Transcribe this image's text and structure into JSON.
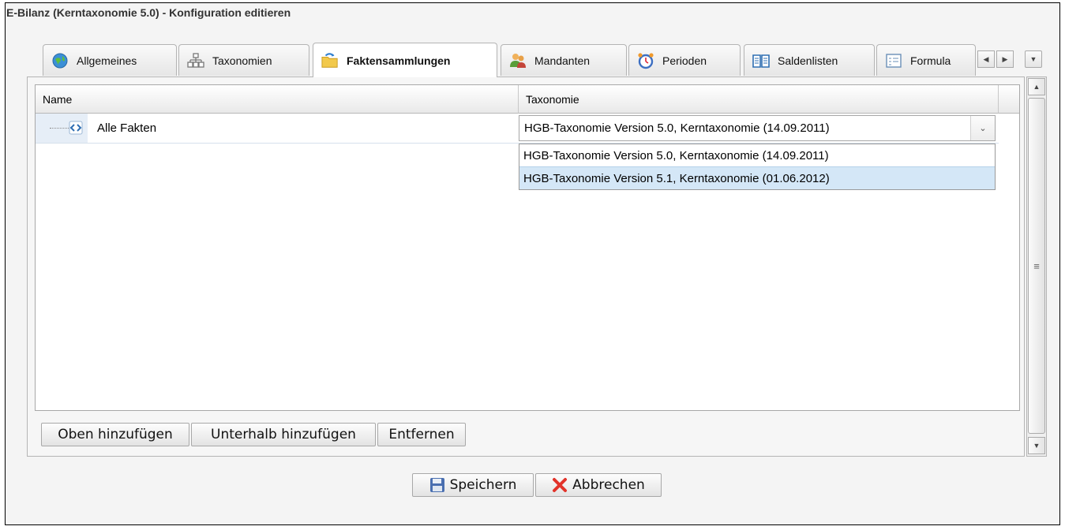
{
  "window": {
    "title": "E-Bilanz (Kerntaxonomie 5.0) - Konfiguration editieren"
  },
  "tabs": [
    {
      "label": "Allgemeines",
      "icon": "globe-icon",
      "active": false
    },
    {
      "label": "Taxonomien",
      "icon": "hierarchy-icon",
      "active": false
    },
    {
      "label": "Faktensammlungen",
      "icon": "folder-arrow-icon",
      "active": true
    },
    {
      "label": "Mandanten",
      "icon": "people-icon",
      "active": false
    },
    {
      "label": "Perioden",
      "icon": "alarm-clock-icon",
      "active": false
    },
    {
      "label": "Saldenlisten",
      "icon": "book-icon",
      "active": false
    },
    {
      "label": "Formula",
      "icon": "form-icon",
      "active": false
    }
  ],
  "grid": {
    "columns": [
      "Name",
      "Taxonomie"
    ],
    "rows": [
      {
        "name": "Alle Fakten",
        "taxonomie": "HGB-Taxonomie Version 5.0, Kerntaxonomie (14.09.2011)"
      }
    ],
    "dropdown_options": [
      "HGB-Taxonomie Version 5.0, Kerntaxonomie (14.09.2011)",
      "HGB-Taxonomie Version 5.1, Kerntaxonomie (01.06.2012)"
    ],
    "highlighted_option_index": 1
  },
  "grid_actions": {
    "add_above": "Oben hinzufügen",
    "add_below": "Unterhalb hinzufügen",
    "remove": "Entfernen"
  },
  "footer": {
    "save": "Speichern",
    "cancel": "Abbrechen"
  },
  "colors": {
    "selection": "#d4e7f7",
    "cancel_icon": "#e2332a",
    "save_icon": "#4a6fb0"
  }
}
